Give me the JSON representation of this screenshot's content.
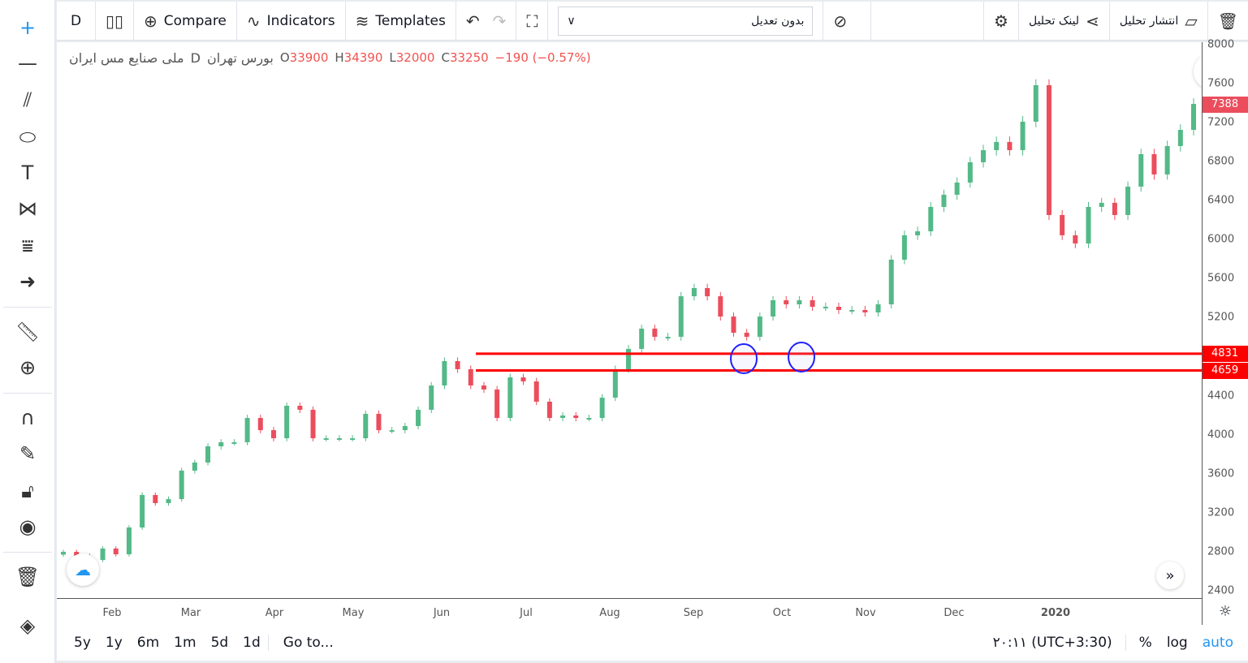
{
  "toolbar": {
    "interval": "D",
    "compare": "Compare",
    "indicators": "Indicators",
    "templates": "Templates",
    "adjustment": "بدون تعدیل",
    "share_link": "لینک تحلیل",
    "publish": "انتشار تحلیل"
  },
  "legend": {
    "symbol": "ملی صنایع مس ایران",
    "interval": "D",
    "exchange": "بورس تهران",
    "open_label": "O",
    "open": "33900",
    "high_label": "H",
    "high": "34390",
    "low_label": "L",
    "low": "32000",
    "close_label": "C",
    "close": "33250",
    "change": "−190 (−0.57%)"
  },
  "bottom": {
    "ranges": [
      "5y",
      "1y",
      "6m",
      "1m",
      "5d",
      "1d"
    ],
    "goto": "Go to...",
    "time": "۲۰:۱۱ (UTC+3:30)",
    "percent": "%",
    "log": "log",
    "auto": "auto"
  },
  "colors": {
    "up": "#53b987",
    "down": "#eb4d5c",
    "level_line": "#ff0000",
    "ellipse": "#1e1eff",
    "accent": "#2196f3"
  },
  "chart_data": {
    "type": "candlestick",
    "title": "",
    "ylim": [
      2400,
      8000
    ],
    "y_ticks": [
      "8000",
      "7600",
      "7200",
      "6800",
      "6400",
      "6000",
      "5600",
      "5200",
      "4800",
      "4400",
      "4000",
      "3600",
      "3200",
      "2800",
      "2400"
    ],
    "x_ticks": [
      "Feb",
      "Mar",
      "Apr",
      "May",
      "Jun",
      "Jul",
      "Aug",
      "Sep",
      "Oct",
      "Nov",
      "Dec",
      "2020"
    ],
    "last_price": "7388",
    "horizontal_levels": [
      "4831",
      "4659"
    ],
    "closes": [
      2799,
      2758,
      2716,
      2833,
      2774,
      3049,
      3382,
      3299,
      3340,
      3632,
      3715,
      3881,
      3923,
      3923,
      4172,
      4047,
      3964,
      4297,
      4256,
      3964,
      3964,
      3964,
      3964,
      4214,
      4047,
      4047,
      4089,
      4256,
      4505,
      4755,
      4672,
      4505,
      4464,
      4172,
      4588,
      4547,
      4339,
      4172,
      4197,
      4172,
      4172,
      4380,
      4672,
      4880,
      5088,
      5004,
      5004,
      5420,
      5504,
      5420,
      5212,
      5046,
      5004,
      5212,
      5379,
      5337,
      5379,
      5312,
      5312,
      5279,
      5279,
      5254,
      5337,
      5795,
      6045,
      6086,
      6336,
      6461,
      6586,
      6794,
      6918,
      7002,
      6918,
      7210,
      7584,
      6253,
      6045,
      5961,
      6336,
      6378,
      6253,
      6544,
      6877,
      6669,
      6960,
      7126,
      7392
    ]
  }
}
